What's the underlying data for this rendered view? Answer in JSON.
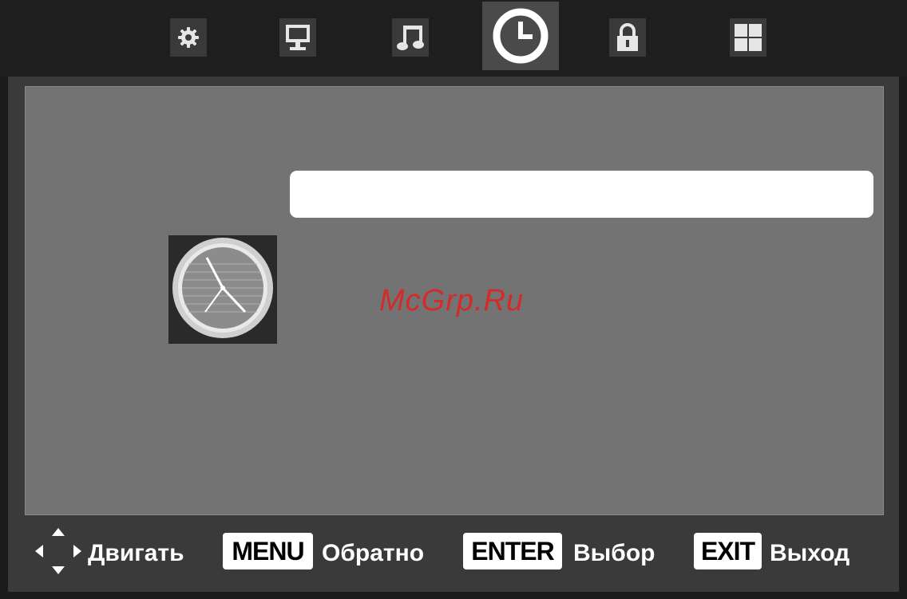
{
  "tabs": [
    {
      "icon": "gear-icon",
      "active": false
    },
    {
      "icon": "monitor-icon",
      "active": false
    },
    {
      "icon": "music-note-icon",
      "active": false
    },
    {
      "icon": "clock-icon",
      "active": true
    },
    {
      "icon": "lock-icon",
      "active": false
    },
    {
      "icon": "grid-icon",
      "active": false
    }
  ],
  "section_icon": "analog-clock-icon",
  "watermark": "McGrp.Ru",
  "footer": {
    "move_label": "Двигать",
    "menu_key": "MENU",
    "menu_label": "Обратно",
    "enter_key": "ENTER",
    "enter_label": "Выбор",
    "exit_key": "EXIT",
    "exit_label": "Выход"
  },
  "colors": {
    "panel": "#737373",
    "highlight": "#ffffff",
    "watermark": "#d42a2a"
  }
}
